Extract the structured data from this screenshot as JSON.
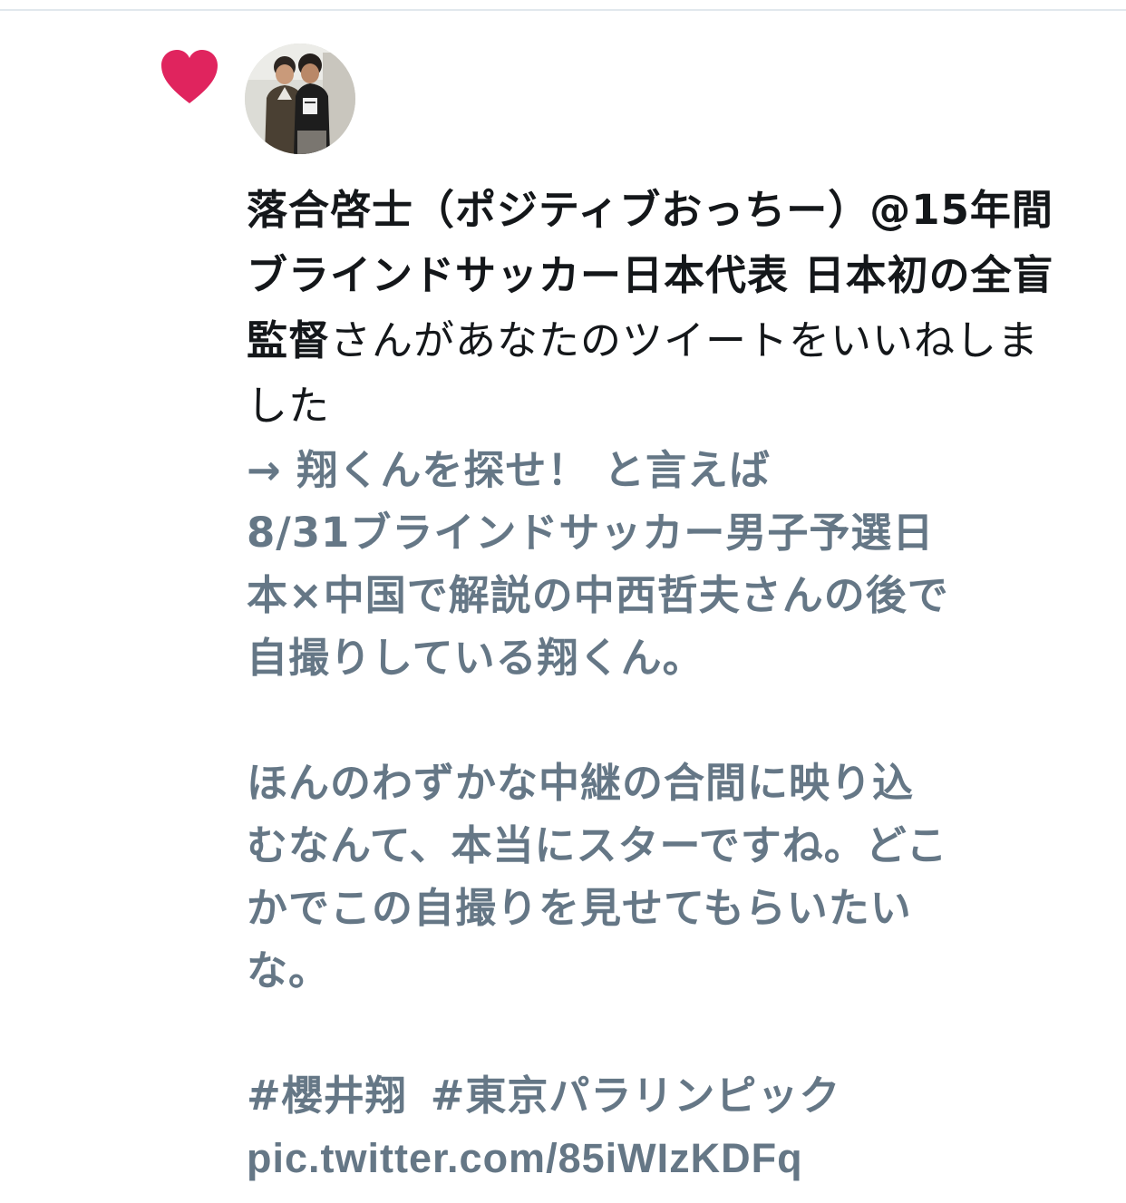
{
  "notification": {
    "type_icon": "heart-icon",
    "accent_color": "#e0245e",
    "avatar_alt": "profile photo",
    "actor_name": "落合啓士（ポジティブおっちー）@15年間ブラインドサッカー日本代表 日本初の全盲監督",
    "action_text": "さんがあなたのツイートをいいねしました",
    "tweet_lines": [
      "→ 翔くんを探せ！ と言えば",
      "8/31ブラインドサッカー男子予選日",
      "本×中国で解説の中西哲夫さんの後で",
      "自撮りしている翔くん。",
      "",
      "ほんのわずかな中継の合間に映り込",
      "むなんて、本当にスターですね。どこ",
      "かでこの自撮りを見せてもらいたい",
      "な。",
      ""
    ],
    "hashtags": [
      "#櫻井翔",
      "#東京パラリンピック"
    ],
    "link": "pic.twitter.com/85iWIzKDFq"
  }
}
